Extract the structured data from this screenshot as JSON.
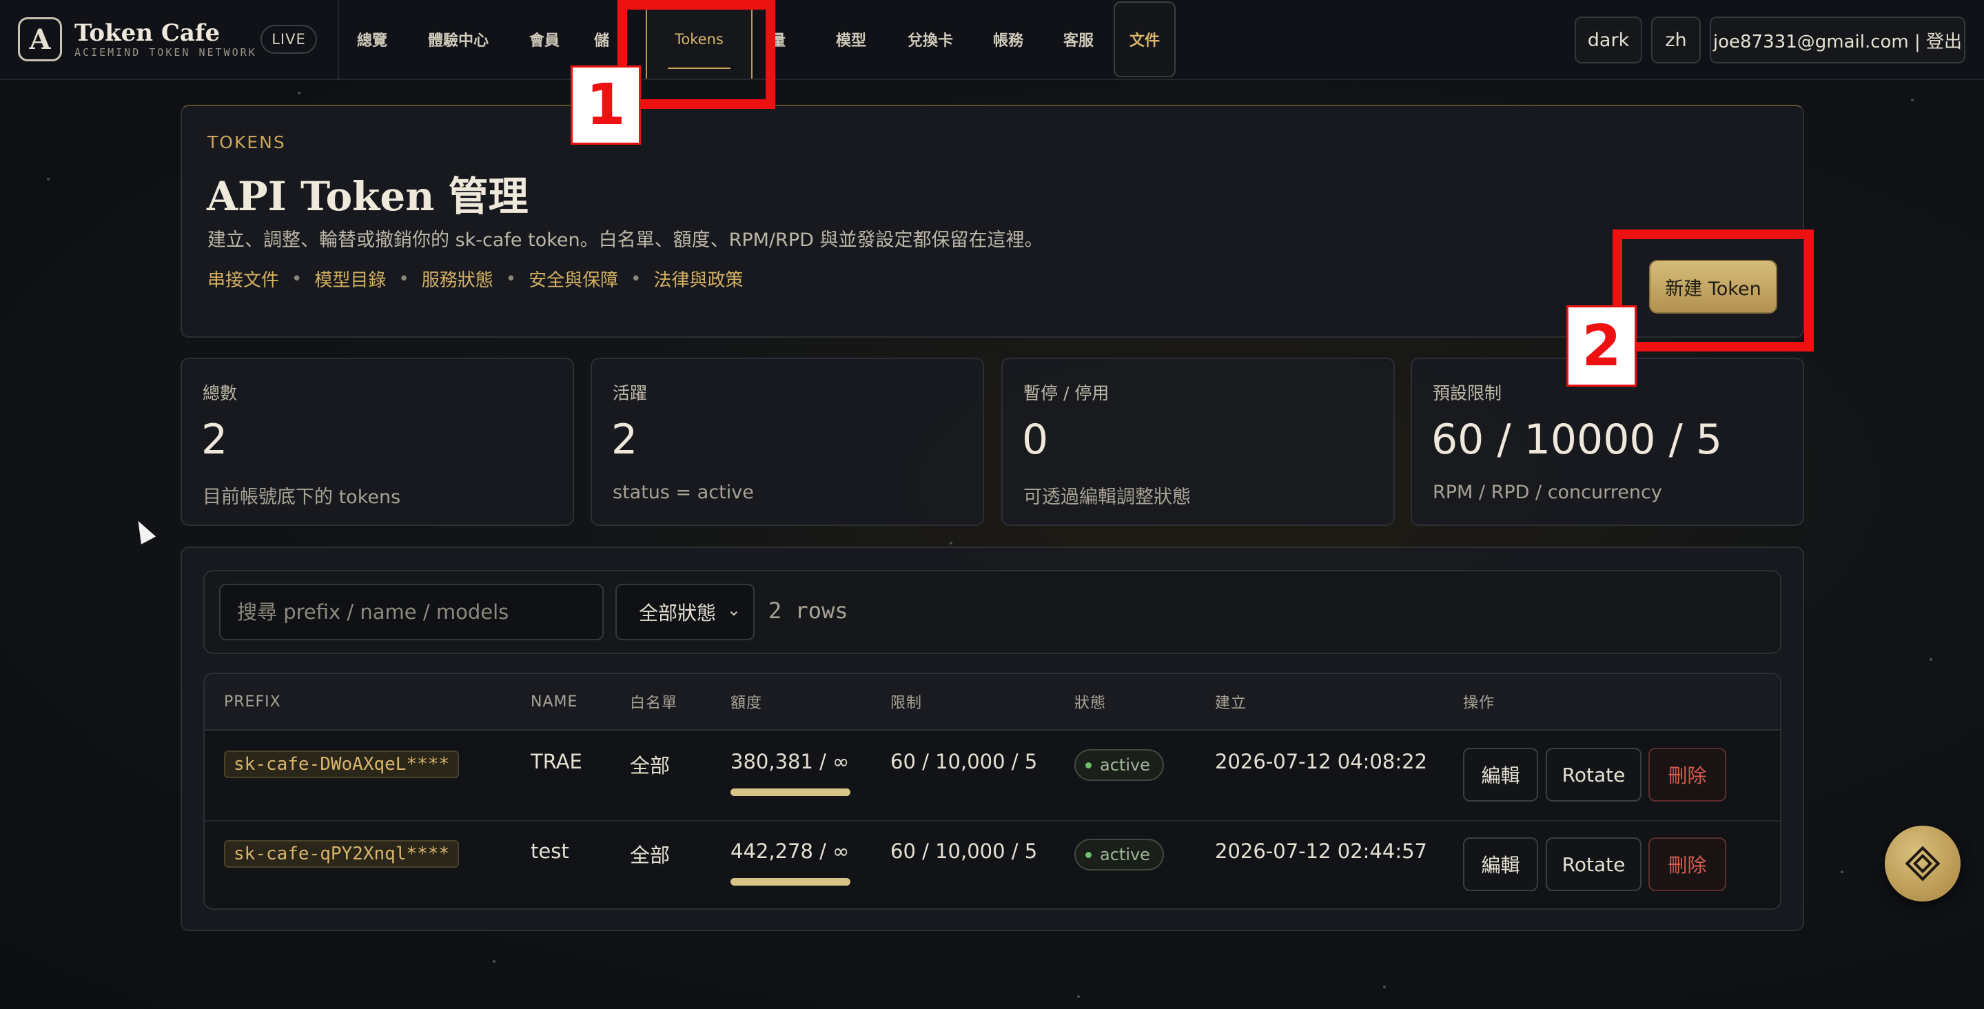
{
  "brand": {
    "name": "Token Cafe",
    "subtitle": "ACIEMIND TOKEN NETWORK",
    "logo_letter": "A",
    "live": "LIVE"
  },
  "nav": {
    "items": [
      "總覽",
      "體驗中心",
      "會員",
      "儲",
      "Tokens",
      "量",
      "模型",
      "兌換卡",
      "帳務",
      "客服",
      "文件"
    ],
    "active": "Tokens"
  },
  "top_right": {
    "theme": "dark",
    "lang": "zh",
    "account": "joe87331@gmail.com | 登出"
  },
  "annotations": {
    "one": "1",
    "two": "2",
    "color": "#ee1111"
  },
  "header": {
    "eyebrow": "TOKENS",
    "title": "API Token 管理",
    "description": "建立、調整、輪替或撤銷你的 sk-cafe token。白名單、額度、RPM/RPD 與並發設定都保留在這裡。",
    "links": [
      "串接文件",
      "模型目錄",
      "服務狀態",
      "安全與保障",
      "法律與政策"
    ],
    "new_button": "新建 Token"
  },
  "stats": [
    {
      "label": "總數",
      "value": "2",
      "sub": "目前帳號底下的 tokens"
    },
    {
      "label": "活躍",
      "value": "2",
      "sub": "status = active"
    },
    {
      "label": "暫停 / 停用",
      "value": "0",
      "sub": "可透過編輯調整狀態"
    },
    {
      "label": "預設限制",
      "value": "60 / 10000 / 5",
      "sub": "RPM / RPD / concurrency"
    }
  ],
  "filters": {
    "search_placeholder": "搜尋 prefix / name / models",
    "status_select": "全部狀態",
    "row_count": "2 rows"
  },
  "table": {
    "headers": [
      "PREFIX",
      "NAME",
      "白名單",
      "額度",
      "限制",
      "狀態",
      "建立",
      "操作"
    ],
    "rows": [
      {
        "prefix": "sk-cafe-DWoAXqeL****",
        "name": "TRAE",
        "whitelist": "全部",
        "quota": "380,381 / ∞",
        "quota_fill": 1.0,
        "limits": "60 / 10,000 / 5",
        "status": "active",
        "created": "2026-07-12 04:08:22"
      },
      {
        "prefix": "sk-cafe-qPY2Xnql****",
        "name": "test",
        "whitelist": "全部",
        "quota": "442,278 / ∞",
        "quota_fill": 1.0,
        "limits": "60 / 10,000 / 5",
        "status": "active",
        "created": "2026-07-12 02:44:57"
      }
    ],
    "actions": {
      "edit": "編輯",
      "rotate": "Rotate",
      "delete": "刪除"
    }
  },
  "colors": {
    "accent_gold": "#d4b062",
    "background": "#0c0e12",
    "danger": "#d35b4e",
    "success": "#6bbf6b"
  },
  "icons": {
    "chevron": "chevron-down-icon",
    "fab": "diamond-icon",
    "cursor": "mouse-cursor-icon"
  }
}
